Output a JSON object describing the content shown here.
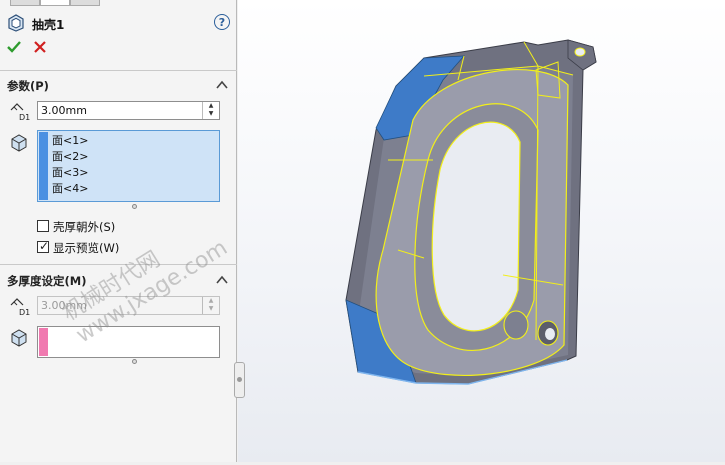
{
  "feature": {
    "title": "抽壳1",
    "help_label": "?"
  },
  "parameters": {
    "section_title": "参数(P)",
    "thickness_value": "3.00mm",
    "faces": [
      "面<1>",
      "面<2>",
      "面<3>",
      "面<4>"
    ],
    "faces_color": "#4a90e2",
    "shell_outward_label": "壳厚朝外(S)",
    "shell_outward_checked": false,
    "show_preview_label": "显示预览(W)",
    "show_preview_checked": true
  },
  "multi_thickness": {
    "section_title": "多厚度设定(M)",
    "thickness_value": "3.00mm",
    "faces_color": "#f07ab0"
  },
  "watermark": {
    "line1": "机械时代网",
    "line2": "www.jxage.com"
  },
  "icons": {
    "ok": "check-icon",
    "cancel": "x-icon",
    "thickness": "d1-thickness-icon",
    "faces": "cube-icon"
  }
}
